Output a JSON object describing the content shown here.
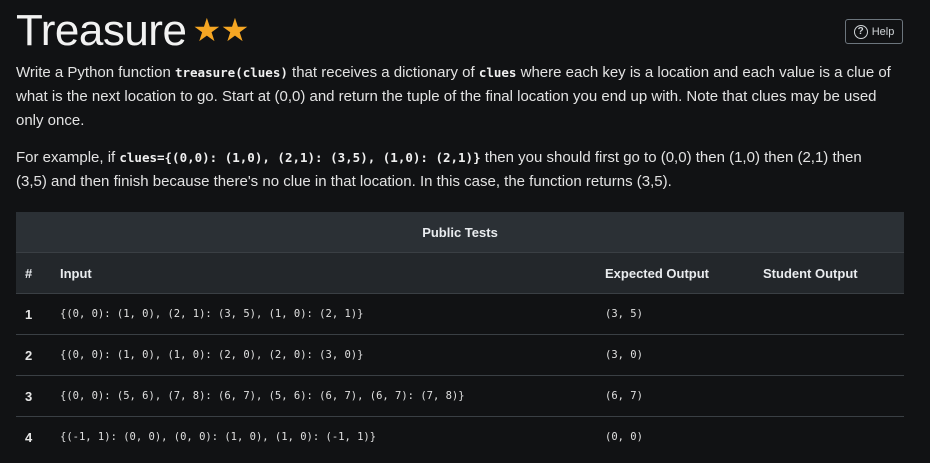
{
  "header": {
    "title": "Treasure",
    "stars": "★★",
    "help_label": "Help"
  },
  "description": {
    "p1_a": "Write a Python function ",
    "p1_code1": "treasure(clues)",
    "p1_b": " that receives a dictionary of ",
    "p1_code2": "clues",
    "p1_c": " where each key is a location and each value is a clue of what is the next location to go. Start at (0,0) and return the tuple of the final location you end up with. Note that clues may be used only once.",
    "p2_a": "For example, if ",
    "p2_code": "clues={(0,0): (1,0), (2,1): (3,5), (1,0): (2,1)}",
    "p2_b": " then you should first go to (0,0) then (1,0) then (2,1) then (3,5) and then finish because there's no clue in that location. In this case, the function returns (3,5)."
  },
  "tests": {
    "title": "Public Tests",
    "columns": [
      "#",
      "Input",
      "Expected Output",
      "Student Output"
    ],
    "rows": [
      {
        "num": "1",
        "input": "{(0, 0): (1, 0), (2, 1): (3, 5), (1, 0): (2, 1)}",
        "expected": "(3, 5)",
        "student": ""
      },
      {
        "num": "2",
        "input": "{(0, 0): (1, 0), (1, 0): (2, 0), (2, 0): (3, 0)}",
        "expected": "(3, 0)",
        "student": ""
      },
      {
        "num": "3",
        "input": "{(0, 0): (5, 6), (7, 8): (6, 7), (5, 6): (6, 7), (6, 7): (7, 8)}",
        "expected": "(6, 7)",
        "student": ""
      },
      {
        "num": "4",
        "input": "{(-1, 1): (0, 0), (0, 0): (1, 0), (1, 0): (-1, 1)}",
        "expected": "(0, 0)",
        "student": ""
      }
    ]
  }
}
